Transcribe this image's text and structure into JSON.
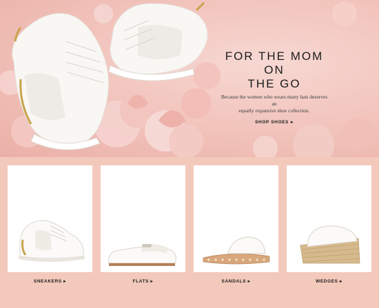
{
  "hero": {
    "title_line1": "FOR THE MOM ON",
    "title_line2": "THE GO",
    "subtitle_line1": "Because the women who wears many hats deserves an",
    "subtitle_line2": "equally expansive shoe collection.",
    "cta_label": "SHOP SHOES",
    "cta_icon": "chevron-right-icon"
  },
  "categories": [
    {
      "label": "SNEAKERS",
      "icon": "chevron-right-icon"
    },
    {
      "label": "FLATS",
      "icon": "chevron-right-icon"
    },
    {
      "label": "SANDALS",
      "icon": "chevron-right-icon"
    },
    {
      "label": "WEDGES",
      "icon": "chevron-right-icon"
    }
  ],
  "colors": {
    "background": "#f3c9bb",
    "hero_pink": "#f1c2ba",
    "text": "#1c1c1c",
    "gold_accent": "#c9a24a"
  }
}
